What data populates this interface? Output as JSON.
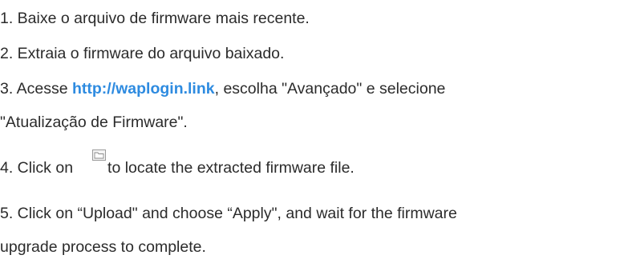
{
  "steps": {
    "s1": "1. Baixe o arquivo de firmware mais recente.",
    "s2": "2. Extraia o firmware do arquivo baixado.",
    "s3_prefix": "3. Acesse ",
    "s3_link": "http://waplogin.link",
    "s3_suffix": ", escolha \"Avançado\" e selecione",
    "s3_line2": "\"Atualização de Firmware\".",
    "s4_prefix": "4. Click on",
    "s4_suffix": "to locate the extracted firmware file.",
    "s5_line1": "5. Click on “Upload\" and choose “Apply\", and wait for the firmware",
    "s5_line2": "upgrade process to complete."
  },
  "icons": {
    "browse": "folder-icon"
  },
  "colors": {
    "text": "#2b2b2b",
    "link": "#2e8be0"
  }
}
